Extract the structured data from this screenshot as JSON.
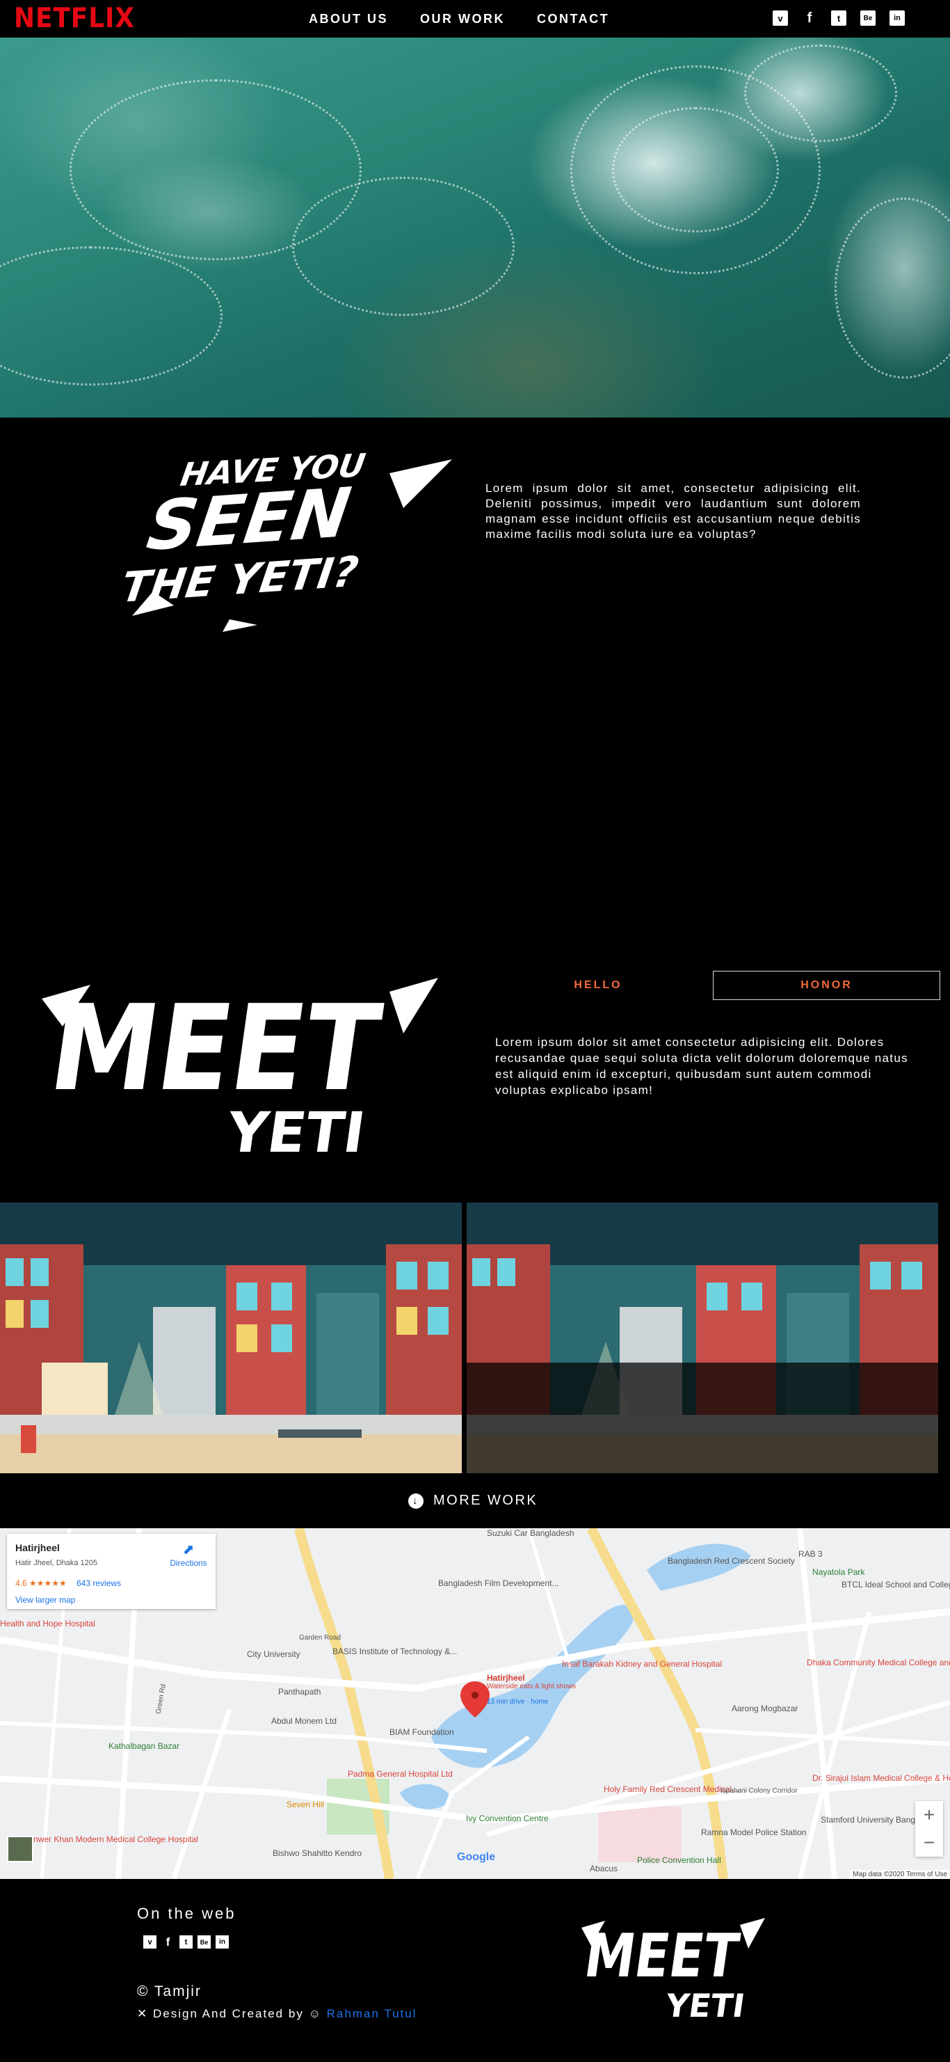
{
  "nav": {
    "logo": "NETFLIX",
    "menu": [
      "ABOUT US",
      "OUR WORK",
      "CONTACT"
    ],
    "social": [
      "vimeo-icon",
      "facebook-icon",
      "twitter-icon",
      "behance-icon",
      "linkedin-icon"
    ]
  },
  "section1": {
    "paragraph": "Lorem ipsum dolor sit amet, consectetur adipisicing elit. Deleniti possimus, impedit vero laudantium sunt dolorem magnam esse incidunt officiis est accusantium neque debitis maxime facilis modi soluta iure ea voluptas?"
  },
  "section2": {
    "tabs": [
      "HELLO",
      "HONOR"
    ],
    "paragraph": "Lorem ipsum dolor sit amet consectetur adipisicing elit. Dolores recusandae quae sequi soluta dicta velit dolorum doloremque natus est aliquid enim id excepturi, quibusdam sunt autem commodi voluptas explicabo ipsam!"
  },
  "more_work": "MORE WORK",
  "map": {
    "place_name": "Hatirjheel",
    "address": "Hatir Jheel, Dhaka 1205",
    "rating": "4.6 ★★★★★",
    "reviews": "643 reviews",
    "view_larger": "View larger map",
    "directions": "Directions",
    "attribution": "Map data ©2020   Terms of Use",
    "google": "Google",
    "labels": {
      "film": "Bangladesh Film Development...",
      "city_uni": "City University",
      "basis": "BASIS Institute of Technology &...",
      "panthapath": "Panthapath",
      "abdul": "Abdul Monem Ltd",
      "kathalbagan": "Kathalbagan Bazar",
      "biam": "BIAM Foundation",
      "padma": "Padma General Hospital Ltd",
      "seven_hill": "Seven Hill",
      "ivy": "Ivy Convention Centre",
      "bishwo": "Bishwo Shahitto Kendro",
      "anwer": "Anwer Khan Modern Medical College Hospital",
      "health": "Health and Hope Hospital",
      "hatirjheel": "Hatirjheel",
      "hatir_sub": "Waterside eats & light shows",
      "hatir_drive": "13 min drive · home",
      "insaf": "Insaf Barakah Kidney and General Hospital",
      "holy": "Holy Family Red Crescent Medical...",
      "ramna": "Ramna Model Police Station",
      "police_hall": "Police Convention Hall",
      "aarong": "Aarong Mogbazar",
      "redcross": "Bangladesh Red Crescent Society",
      "rab": "RAB 3",
      "nayatola": "Nayatola Park",
      "btcl": "BTCL Ideal School and College",
      "dhaka_comm": "Dhaka Community Medical College and...",
      "sirajul": "Dr. Sirajul Islam Medical College & Hospital Ltd",
      "stamford": "Stamford University Bangladesh",
      "abacus": "Abacus",
      "suzuki": "Suzuki Car Bangladesh",
      "green_rd": "Green Rd",
      "gardern": "Garden Road",
      "ispahani": "Ispahani Colony Corridor"
    }
  },
  "footer": {
    "heading": "On the web",
    "social": [
      "vimeo-icon",
      "facebook-icon",
      "twitter-icon",
      "behance-icon",
      "linkedin-icon"
    ],
    "copyright": "© Tamjir",
    "credit_prefix": "Design And Created by",
    "author": "Rahman Tutul"
  },
  "colors": {
    "brand": "#e50914",
    "accent": "#f26b3a",
    "link": "#1a73e8"
  }
}
